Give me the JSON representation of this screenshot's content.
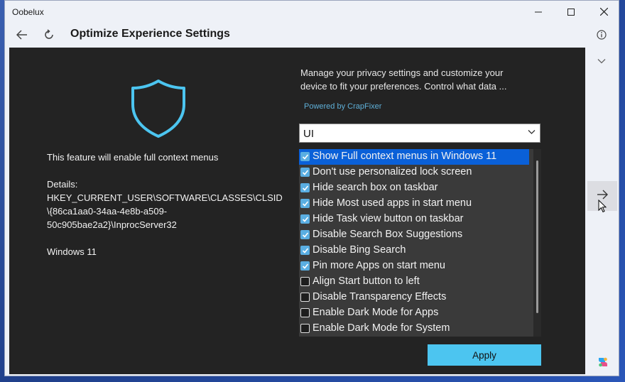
{
  "window": {
    "app_title": "Oobelux",
    "minimize_icon": "minimize-icon",
    "maximize_icon": "maximize-icon",
    "close_icon": "close-icon"
  },
  "nav": {
    "back_icon": "back-arrow-icon",
    "refresh_icon": "refresh-icon",
    "page_title": "Optimize Experience Settings",
    "info_icon": "info-icon"
  },
  "left": {
    "shield_icon": "shield-icon",
    "feature_text": "This feature will enable full context menus",
    "details_label": "Details:",
    "details_lines": [
      "HKEY_CURRENT_USER\\SOFTWARE\\CLASSES\\CLSID",
      "\\{86ca1aa0-34aa-4e8b-a509-",
      "50c905bae2a2}\\InprocServer32"
    ],
    "os_text": "Windows 11"
  },
  "right": {
    "description_lines": [
      "Manage your privacy settings and customize your",
      "device to fit your preferences. Control what data ..."
    ],
    "powered_by": "Powered by CrapFixer",
    "category_select": {
      "value": "UI"
    },
    "options": [
      {
        "label": "Show Full context menus in Windows 11",
        "checked": true,
        "selected": true
      },
      {
        "label": "Don't use personalized lock screen",
        "checked": true,
        "selected": false
      },
      {
        "label": "Hide search box on taskbar",
        "checked": true,
        "selected": false
      },
      {
        "label": "Hide Most used apps in start menu",
        "checked": true,
        "selected": false
      },
      {
        "label": "Hide Task view button on taskbar",
        "checked": true,
        "selected": false
      },
      {
        "label": "Disable Search Box Suggestions",
        "checked": true,
        "selected": false
      },
      {
        "label": "Disable Bing Search",
        "checked": true,
        "selected": false
      },
      {
        "label": "Pin more Apps on start menu",
        "checked": true,
        "selected": false
      },
      {
        "label": "Align Start button to left",
        "checked": false,
        "selected": false
      },
      {
        "label": "Disable Transparency Effects",
        "checked": false,
        "selected": false
      },
      {
        "label": "Enable Dark Mode for Apps",
        "checked": false,
        "selected": false
      },
      {
        "label": "Enable Dark Mode for System",
        "checked": false,
        "selected": false
      }
    ],
    "apply_label": "Apply"
  },
  "sidebar": {
    "chevron_icon": "chevron-down-icon",
    "next_icon": "arrow-right-icon",
    "copilot_icon": "copilot-icon"
  },
  "colors": {
    "panel_bg": "#232323",
    "accent": "#4cc5f0",
    "shield": "#4cc5f0",
    "selection": "#0a60d8"
  }
}
